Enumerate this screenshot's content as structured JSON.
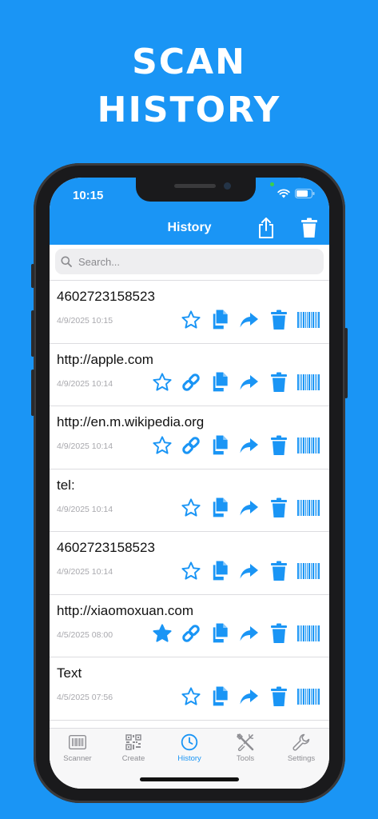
{
  "promo": {
    "line1": "SCAN",
    "line2": "HISTORY"
  },
  "status_bar": {
    "time": "10:15"
  },
  "nav": {
    "title": "History",
    "share_icon": "share-icon",
    "trash_icon": "trash-icon"
  },
  "search": {
    "placeholder": "Search..."
  },
  "colors": {
    "accent": "#1a95f5",
    "date": "#a8a8ad"
  },
  "rows": [
    {
      "text": "4602723158523",
      "date": "4/9/2025 10:15",
      "favorite": false,
      "link": false
    },
    {
      "text": "http://apple.com",
      "date": "4/9/2025 10:14",
      "favorite": false,
      "link": true
    },
    {
      "text": "http://en.m.wikipedia.org",
      "date": "4/9/2025 10:14",
      "favorite": false,
      "link": true
    },
    {
      "text": "tel:",
      "date": "4/9/2025 10:14",
      "favorite": false,
      "link": false
    },
    {
      "text": "4602723158523",
      "date": "4/9/2025 10:14",
      "favorite": false,
      "link": false
    },
    {
      "text": "http://xiaomoxuan.com",
      "date": "4/5/2025 08:00",
      "favorite": true,
      "link": true
    },
    {
      "text": "Text",
      "date": "4/5/2025 07:56",
      "favorite": false,
      "link": false
    }
  ],
  "tabs": [
    {
      "label": "Scanner",
      "icon": "barcode-icon",
      "active": false
    },
    {
      "label": "Create",
      "icon": "qr-code-icon",
      "active": false
    },
    {
      "label": "History",
      "icon": "clock-icon",
      "active": true
    },
    {
      "label": "Tools",
      "icon": "tools-icon",
      "active": false
    },
    {
      "label": "Settings",
      "icon": "wrench-icon",
      "active": false
    }
  ]
}
